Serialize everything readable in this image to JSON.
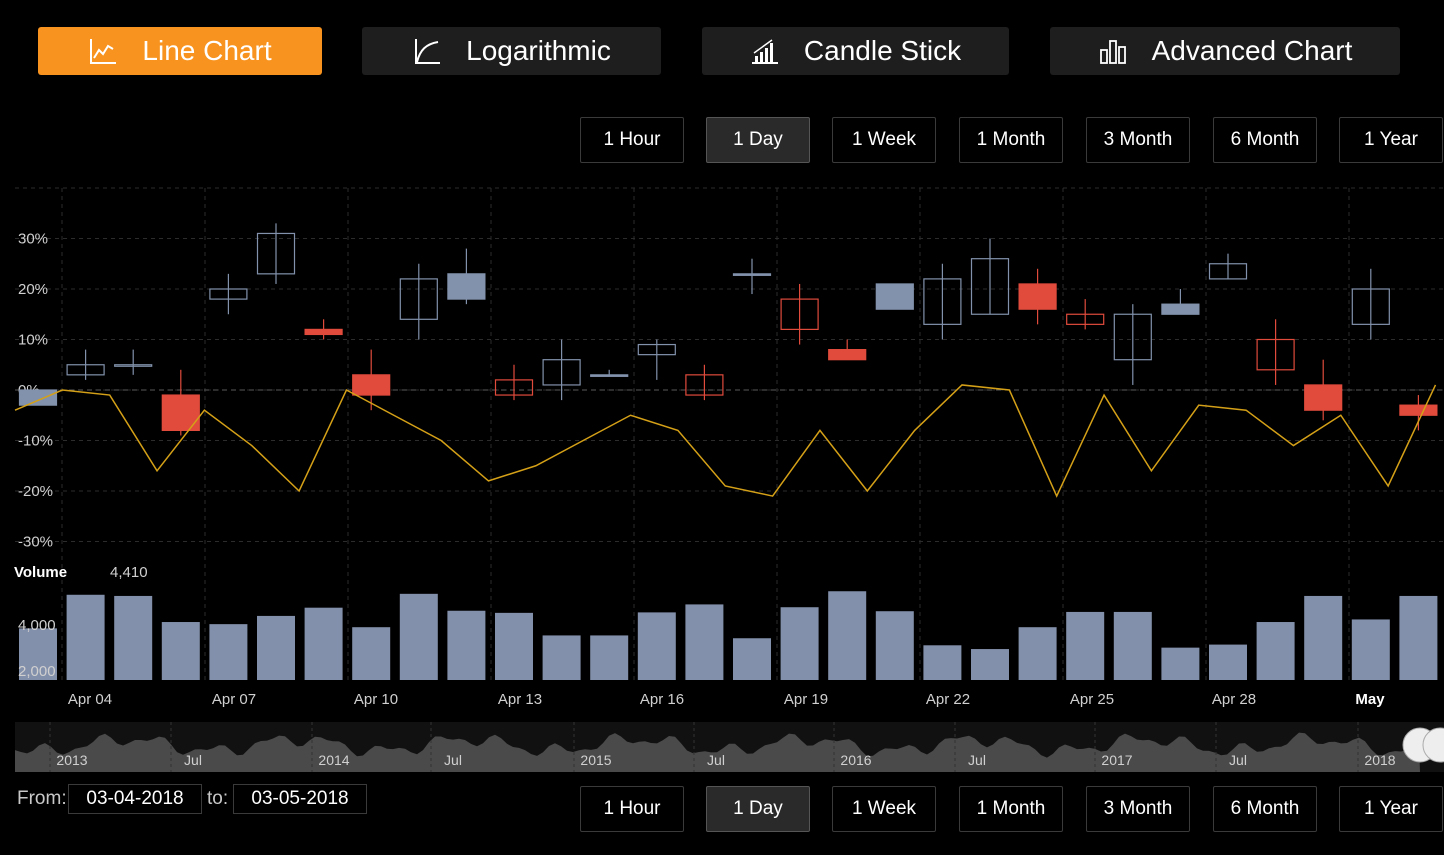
{
  "tabs": [
    {
      "label": "Line Chart",
      "icon": "line-chart-icon",
      "active": true
    },
    {
      "label": "Logarithmic",
      "icon": "log-curve-icon",
      "active": false
    },
    {
      "label": "Candle Stick",
      "icon": "signal-bars-icon",
      "active": false
    },
    {
      "label": "Advanced Chart",
      "icon": "bar-chart-icon",
      "active": false
    }
  ],
  "ranges_top": [
    "1 Hour",
    "1 Day",
    "1 Week",
    "1 Month",
    "3 Month",
    "6 Month",
    "1 Year"
  ],
  "ranges_bottom": [
    "1 Hour",
    "1 Day",
    "1 Week",
    "1 Month",
    "3 Month",
    "6 Month",
    "1 Year"
  ],
  "active_range": "1 Day",
  "from": {
    "label": "From:",
    "value": "03-04-2018"
  },
  "to": {
    "label": "to:",
    "value": "03-05-2018"
  },
  "colors": {
    "accent": "#f7931e",
    "up": "#8292ac",
    "down": "#e04b3c",
    "line": "#d4a017",
    "volume": "#8390ab"
  },
  "chart_data": {
    "type": "candlestick",
    "y_ticks": [
      "30%",
      "20%",
      "10%",
      "0%",
      "-10%",
      "-20%",
      "-30%"
    ],
    "ylim": [
      -30,
      30
    ],
    "x_ticks": [
      "Apr 04",
      "Apr 07",
      "Apr 10",
      "Apr 13",
      "Apr 16",
      "Apr 19",
      "Apr 22",
      "Apr 25",
      "Apr 28",
      "May"
    ],
    "candles": [
      {
        "o": 0,
        "h": 0,
        "l": -3,
        "c": -3,
        "dir": "up"
      },
      {
        "o": 3,
        "h": 8,
        "l": 2,
        "c": 5,
        "dir": "up"
      },
      {
        "o": 5,
        "h": 8,
        "l": 3,
        "c": 5,
        "dir": "up"
      },
      {
        "o": -1,
        "h": 4,
        "l": -9,
        "c": -8,
        "dir": "down"
      },
      {
        "o": 18,
        "h": 23,
        "l": 15,
        "c": 20,
        "dir": "up"
      },
      {
        "o": 23,
        "h": 33,
        "l": 21,
        "c": 31,
        "dir": "up"
      },
      {
        "o": 12,
        "h": 14,
        "l": 10,
        "c": 11,
        "dir": "down"
      },
      {
        "o": 3,
        "h": 8,
        "l": -4,
        "c": -1,
        "dir": "down"
      },
      {
        "o": 14,
        "h": 25,
        "l": 10,
        "c": 22,
        "dir": "up"
      },
      {
        "o": 18,
        "h": 28,
        "l": 17,
        "c": 23,
        "dir": "up"
      },
      {
        "o": 2,
        "h": 5,
        "l": -2,
        "c": -1,
        "dir": "down"
      },
      {
        "o": 1,
        "h": 10,
        "l": -2,
        "c": 6,
        "dir": "up"
      },
      {
        "o": 3,
        "h": 4,
        "l": 3,
        "c": 3,
        "dir": "up"
      },
      {
        "o": 7,
        "h": 10,
        "l": 2,
        "c": 9,
        "dir": "up"
      },
      {
        "o": 3,
        "h": 5,
        "l": -2,
        "c": -1,
        "dir": "down"
      },
      {
        "o": 23,
        "h": 26,
        "l": 19,
        "c": 23,
        "dir": "up"
      },
      {
        "o": 18,
        "h": 21,
        "l": 9,
        "c": 12,
        "dir": "down"
      },
      {
        "o": 8,
        "h": 10,
        "l": 6,
        "c": 6,
        "dir": "down"
      },
      {
        "o": 16,
        "h": 21,
        "l": 16,
        "c": 21,
        "dir": "up"
      },
      {
        "o": 13,
        "h": 25,
        "l": 10,
        "c": 22,
        "dir": "up"
      },
      {
        "o": 15,
        "h": 30,
        "l": 15,
        "c": 26,
        "dir": "up"
      },
      {
        "o": 21,
        "h": 24,
        "l": 13,
        "c": 16,
        "dir": "down"
      },
      {
        "o": 15,
        "h": 18,
        "l": 12,
        "c": 13,
        "dir": "down"
      },
      {
        "o": 6,
        "h": 17,
        "l": 1,
        "c": 15,
        "dir": "up"
      },
      {
        "o": 15,
        "h": 20,
        "l": 15,
        "c": 17,
        "dir": "up"
      },
      {
        "o": 22,
        "h": 27,
        "l": 22,
        "c": 25,
        "dir": "up"
      },
      {
        "o": 10,
        "h": 14,
        "l": 1,
        "c": 4,
        "dir": "down"
      },
      {
        "o": 1,
        "h": 6,
        "l": -6,
        "c": -4,
        "dir": "down"
      },
      {
        "o": 13,
        "h": 24,
        "l": 10,
        "c": 20,
        "dir": "up"
      },
      {
        "o": -3,
        "h": -1,
        "l": -8,
        "c": -5,
        "dir": "down"
      }
    ],
    "line_values": [
      -4,
      0,
      -1,
      -16,
      -4,
      -11,
      -20,
      0,
      -5,
      -10,
      -18,
      -15,
      -10,
      -5,
      -8,
      -19,
      -21,
      -8,
      -20,
      -8,
      1,
      0,
      -21,
      -1,
      -16,
      -3,
      -4,
      -11,
      -5,
      -19,
      1
    ],
    "volume": {
      "label": "Volume",
      "current": "4,410",
      "y_ticks": [
        "4,000",
        "2,000"
      ],
      "values": [
        2750,
        4180,
        4130,
        3020,
        2930,
        3280,
        3630,
        2800,
        4220,
        3500,
        3410,
        2450,
        2450,
        3430,
        3770,
        2330,
        3650,
        4330,
        3480,
        2030,
        1870,
        2800,
        3450,
        3450,
        1930,
        2060,
        3020,
        4130,
        3130,
        4130
      ]
    },
    "navigator": {
      "x_ticks": [
        "2013",
        "Jul",
        "2014",
        "Jul",
        "2015",
        "Jul",
        "2016",
        "Jul",
        "2017",
        "Jul",
        "2018"
      ]
    }
  }
}
